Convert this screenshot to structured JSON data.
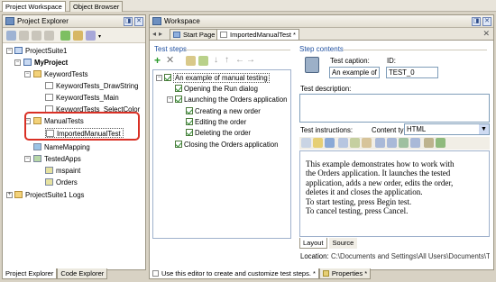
{
  "top_tabs": [
    "Project Workspace",
    "Object Browser"
  ],
  "explorer": {
    "title": "Project Explorer",
    "tree": [
      "ProjectSuite1",
      "MyProject",
      "KeywordTests",
      "KeywordTests_DrawString",
      "KeywordTests_Main",
      "KeywordTests_SelectColor",
      "ManualTests",
      "ImportedManualTest",
      "NameMapping",
      "TestedApps",
      "mspaint",
      "Orders",
      "ProjectSuite1 Logs"
    ],
    "bottom_tabs": [
      "Project Explorer",
      "Code Explorer"
    ]
  },
  "workspace": {
    "title": "Workspace",
    "tabs": [
      "Start Page",
      "ImportedManualTest *"
    ],
    "steps_header": "Test steps",
    "steps": [
      "An example of manual testing",
      "Opening the Run dialog",
      "Launching the Orders application",
      "Creating a new order",
      "Editing the order",
      "Deleting the order",
      "Closing the Orders application"
    ],
    "contents_header": "Step contents",
    "test_caption_label": "Test caption:",
    "test_caption_value": "An example of ma",
    "id_label": "ID:",
    "id_value": "TEST_0",
    "description_label": "Test description:",
    "instructions_label": "Test instructions:",
    "content_type_label": "Content type:",
    "content_type_value": "HTML",
    "instructions_lines": [
      "This example demonstrates how to work with",
      "the Orders application. It launches the tested",
      "application, adds a new order, edits the order,",
      "deletes it and closes the application.",
      "To start testing, press Begin test.",
      "To cancel testing, press Cancel."
    ],
    "editor_tabs": [
      "Layout",
      "Source"
    ],
    "location_label": "Location:",
    "location_value": "C:\\Documents and Settings\\All Users\\Documents\\TestCo",
    "bottom_tabs": [
      "Use this editor to create and customize test steps. *",
      "Properties *"
    ]
  },
  "colors": {
    "highlight": "#d93025",
    "tab_active": "#ffffff",
    "frame": "#9c9684"
  }
}
